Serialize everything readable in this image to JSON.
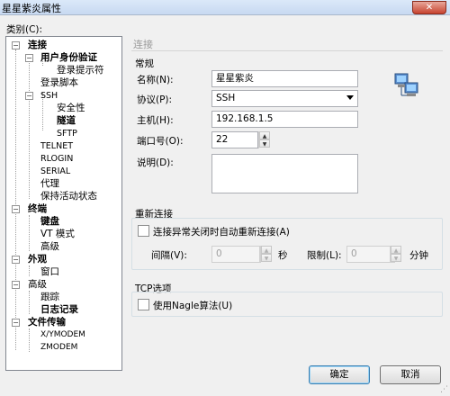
{
  "window": {
    "title": "星星紫炎属性",
    "close": "✕"
  },
  "category_label": "类别(C):",
  "tree": {
    "connection": "连接",
    "auth": "用户身份验证",
    "login_prompt": "登录提示符",
    "login_script": "登录脚本",
    "ssh": "SSH",
    "security": "安全性",
    "tunnel": "隧道",
    "sftp": "SFTP",
    "telnet": "TELNET",
    "rlogin": "RLOGIN",
    "serial": "SERIAL",
    "proxy": "代理",
    "keepalive": "保持活动状态",
    "terminal": "终端",
    "keyboard": "键盘",
    "vt_mode": "VT 模式",
    "advanced_term": "高级",
    "appearance": "外观",
    "window": "窗口",
    "advanced": "高级",
    "trace": "跟踪",
    "logging": "日志记录",
    "file_transfer": "文件传输",
    "xymodem": "X/YMODEM",
    "zmodem": "ZMODEM"
  },
  "panel": {
    "section_title": "连接",
    "general_group": "常规",
    "name_label": "名称(N):",
    "name_value": "星星紫炎",
    "protocol_label": "协议(P):",
    "protocol_value": "SSH",
    "host_label": "主机(H):",
    "host_value": "192.168.1.5",
    "port_label": "端口号(O):",
    "port_value": "22",
    "desc_label": "说明(D):",
    "reconnect_group": "重新连接",
    "reconnect_check": "连接异常关闭时自动重新连接(A)",
    "interval_label": "间隔(V):",
    "interval_value": "0",
    "interval_unit": "秒",
    "limit_label": "限制(L):",
    "limit_value": "0",
    "limit_unit": "分钟",
    "tcp_group": "TCP选项",
    "nagle_check": "使用Nagle算法(U)"
  },
  "buttons": {
    "ok": "确定",
    "cancel": "取消"
  },
  "icons": {
    "spin_up": "▲",
    "spin_down": "▼"
  }
}
